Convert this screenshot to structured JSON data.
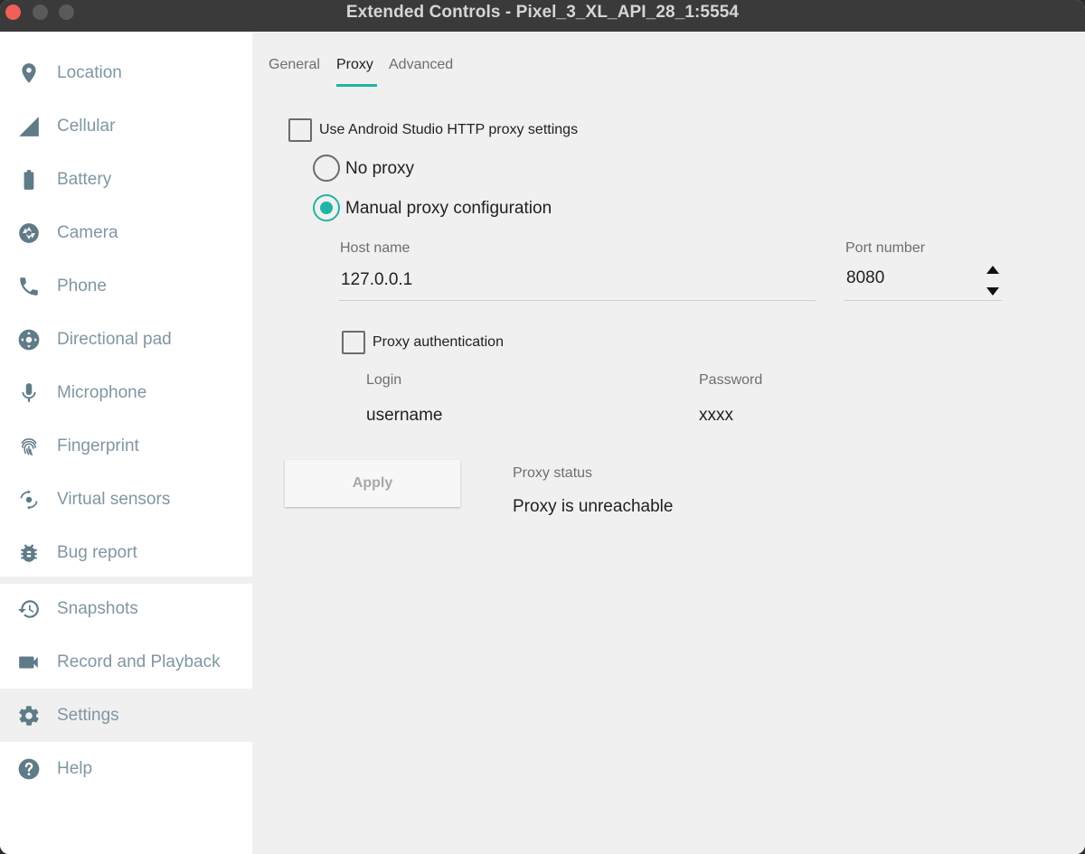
{
  "window": {
    "title": "Extended Controls - Pixel_3_XL_API_28_1:5554"
  },
  "sidebar": {
    "items": [
      {
        "label": "Location",
        "icon": "location-pin-icon"
      },
      {
        "label": "Cellular",
        "icon": "cellular-signal-icon"
      },
      {
        "label": "Battery",
        "icon": "battery-icon"
      },
      {
        "label": "Camera",
        "icon": "camera-aperture-icon"
      },
      {
        "label": "Phone",
        "icon": "phone-icon"
      },
      {
        "label": "Directional pad",
        "icon": "dpad-icon"
      },
      {
        "label": "Microphone",
        "icon": "microphone-icon"
      },
      {
        "label": "Fingerprint",
        "icon": "fingerprint-icon"
      },
      {
        "label": "Virtual sensors",
        "icon": "rotation-icon"
      },
      {
        "label": "Bug report",
        "icon": "bug-icon"
      },
      {
        "label": "Snapshots",
        "icon": "history-icon"
      },
      {
        "label": "Record and Playback",
        "icon": "video-camera-icon"
      },
      {
        "label": "Settings",
        "icon": "gear-icon"
      },
      {
        "label": "Help",
        "icon": "help-icon"
      }
    ],
    "active": "Settings"
  },
  "tabs": [
    {
      "label": "General",
      "active": false
    },
    {
      "label": "Proxy",
      "active": true
    },
    {
      "label": "Advanced",
      "active": false
    }
  ],
  "proxy": {
    "use_studio_label": "Use Android Studio HTTP proxy settings",
    "use_studio_checked": false,
    "no_proxy_label": "No proxy",
    "manual_label": "Manual proxy configuration",
    "selected": "manual",
    "host_label": "Host name",
    "host_value": "127.0.0.1",
    "port_label": "Port number",
    "port_value": "8080",
    "auth_label": "Proxy authentication",
    "auth_checked": false,
    "login_label": "Login",
    "login_value": "username",
    "password_label": "Password",
    "password_value": "xxxx",
    "apply_label": "Apply",
    "status_label": "Proxy status",
    "status_value": "Proxy is unreachable"
  },
  "colors": {
    "accent": "#1fb5a4",
    "sidebar_icon": "#5f7b88",
    "sidebar_text": "#7f97a2",
    "close_button": "#ee5f57"
  }
}
